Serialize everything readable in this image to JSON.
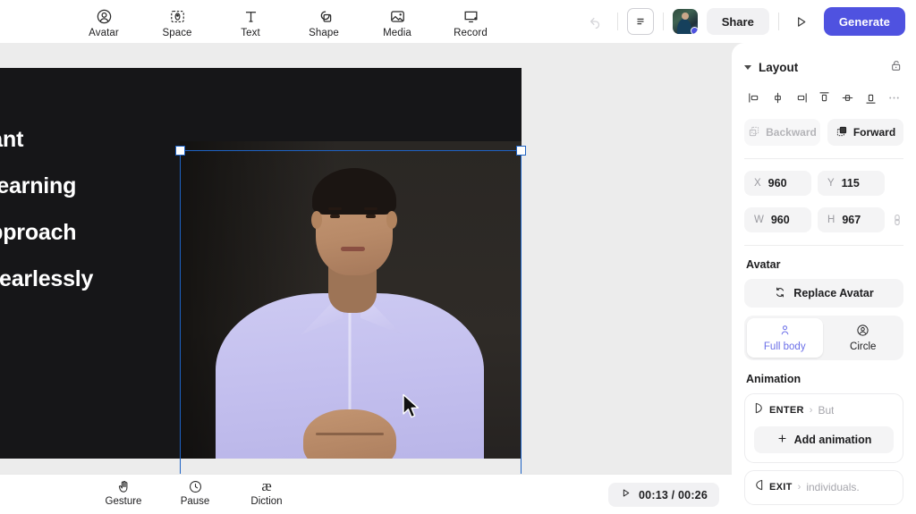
{
  "toolbar": {
    "tools": [
      {
        "label": "Avatar",
        "icon": "avatar-icon"
      },
      {
        "label": "Space",
        "icon": "space-icon"
      },
      {
        "label": "Text",
        "icon": "text-icon"
      },
      {
        "label": "Shape",
        "icon": "shape-icon"
      },
      {
        "label": "Media",
        "icon": "media-icon"
      },
      {
        "label": "Record",
        "icon": "record-icon"
      }
    ],
    "history_icon": "undo-redo-icon",
    "script_icon": "script-document-icon",
    "avatar_icon": "user-avatar-thumbnail",
    "share_label": "Share",
    "preview_icon": "play-preview-icon",
    "generate_label": "Generate",
    "accent_color": "#4f52e0"
  },
  "canvas": {
    "background_color": "#161618",
    "slide_lines": [
      "igilant",
      "us learning",
      "e approach",
      " up fearlessly"
    ],
    "selection_color": "#1e63c4"
  },
  "bottombar": {
    "tools": [
      {
        "label": "Gesture",
        "icon": "hand-gesture-icon"
      },
      {
        "label": "Pause",
        "icon": "clock-pause-icon"
      },
      {
        "label": "Diction",
        "icon": "diction-ae-icon"
      }
    ],
    "time_icon": "play-icon",
    "time_display": "00:13 / 00:26"
  },
  "panel": {
    "layout": {
      "title": "Layout",
      "lock_icon": "unlocked-padlock-icon",
      "align_icons": [
        "align-left-icon",
        "align-center-horizontal-icon",
        "align-right-icon",
        "align-top-icon",
        "align-center-vertical-icon",
        "align-bottom-icon",
        "more-options-icon"
      ],
      "backward_label": "Backward",
      "backward_icon": "send-backward-icon",
      "forward_label": "Forward",
      "forward_icon": "bring-forward-icon",
      "fields": {
        "x_key": "X",
        "x_value": "960",
        "y_key": "Y",
        "y_value": "115",
        "w_key": "W",
        "w_value": "960",
        "h_key": "H",
        "h_value": "967",
        "chain_icon": "aspect-ratio-link-icon"
      }
    },
    "avatar": {
      "title": "Avatar",
      "replace_label": "Replace Avatar",
      "replace_icon": "refresh-replace-icon",
      "modes": [
        {
          "label": "Full body",
          "icon": "person-standing-icon",
          "active": true
        },
        {
          "label": "Circle",
          "icon": "person-circle-icon",
          "active": false
        }
      ],
      "active_color": "#6b6fe8"
    },
    "animation": {
      "title": "Animation",
      "enter": {
        "kind": "ENTER",
        "icon": "enter-arrow-icon",
        "sep": "›",
        "text": "But"
      },
      "add_label": "Add animation",
      "add_icon": "plus-icon",
      "exit": {
        "kind": "EXIT",
        "icon": "exit-arrow-icon",
        "sep": "›",
        "text": "individuals."
      }
    }
  }
}
